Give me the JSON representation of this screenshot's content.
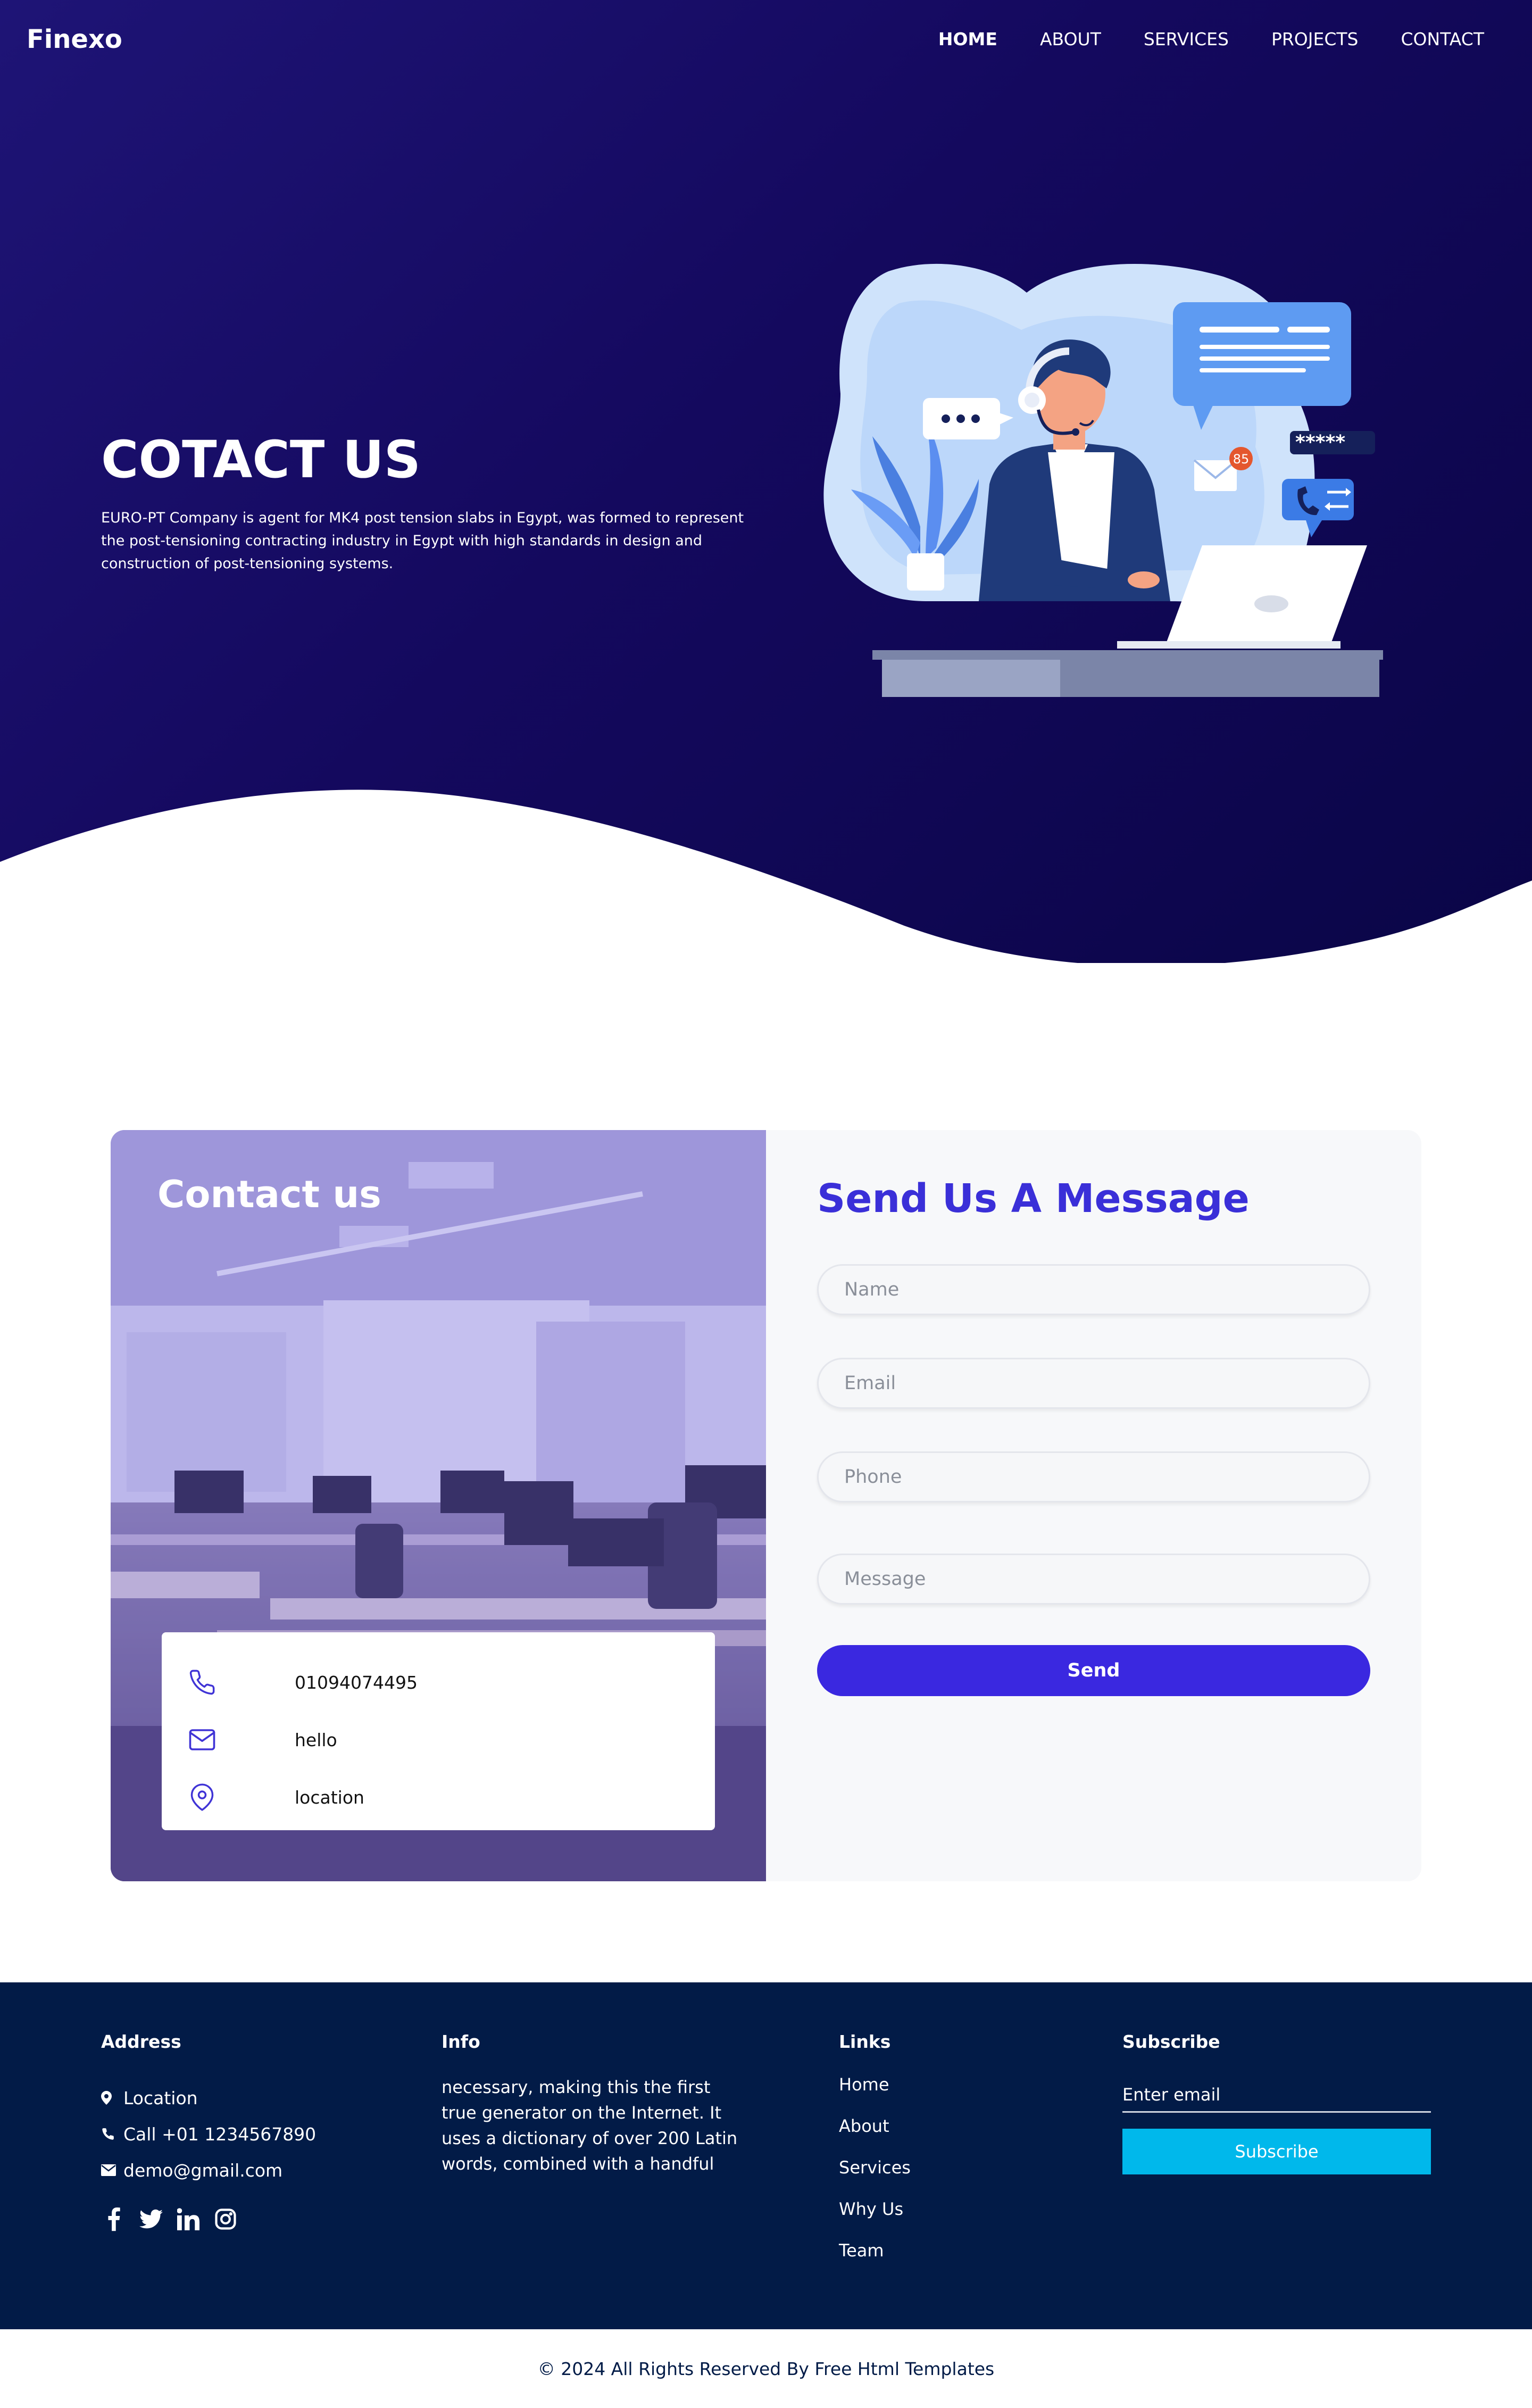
{
  "header": {
    "logo": "Finexo",
    "nav": [
      "HOME",
      "ABOUT",
      "SERVICES",
      "PROJECTS",
      "CONTACT"
    ]
  },
  "hero": {
    "title": "COTACT US",
    "text": "EURO-PT Company is agent for MK4 post tension slabs in Egypt, was formed to represent the post-tensioning contracting industry in Egypt with high standards in design and construction of post-tensioning systems.",
    "illustration": {
      "notification_count": "85",
      "password_mask": "*****"
    }
  },
  "contact": {
    "left_title": "Contact us",
    "phone": "01094074495",
    "email": "hello",
    "location": "location",
    "icons": [
      "phone-icon",
      "mail-icon",
      "location-pin-icon"
    ]
  },
  "form": {
    "title": "Send Us A Message",
    "name_placeholder": "Name",
    "email_placeholder": "Email",
    "phone_placeholder": "Phone",
    "message_placeholder": "Message",
    "send_label": "Send"
  },
  "footer": {
    "address": {
      "heading": "Address",
      "location": "Location",
      "call": "Call +01 1234567890",
      "email": "demo@gmail.com",
      "socials": [
        "facebook-icon",
        "twitter-icon",
        "linkedin-icon",
        "instagram-icon"
      ]
    },
    "info": {
      "heading": "Info",
      "text": "necessary, making this the first true generator on the Internet. It uses a dictionary of over 200 Latin words, combined with a handful"
    },
    "links": {
      "heading": "Links",
      "items": [
        "Home",
        "About",
        "Services",
        "Why Us",
        "Team"
      ]
    },
    "subscribe": {
      "heading": "Subscribe",
      "placeholder": "Enter email",
      "button": "Subscribe"
    }
  },
  "copyright": "© 2024 All Rights Reserved By Free Html Templates",
  "colors": {
    "hero_bg": "#14095e",
    "accent": "#3a28e0",
    "footer_bg": "#021b47",
    "subscribe_btn": "#00b8eb"
  }
}
